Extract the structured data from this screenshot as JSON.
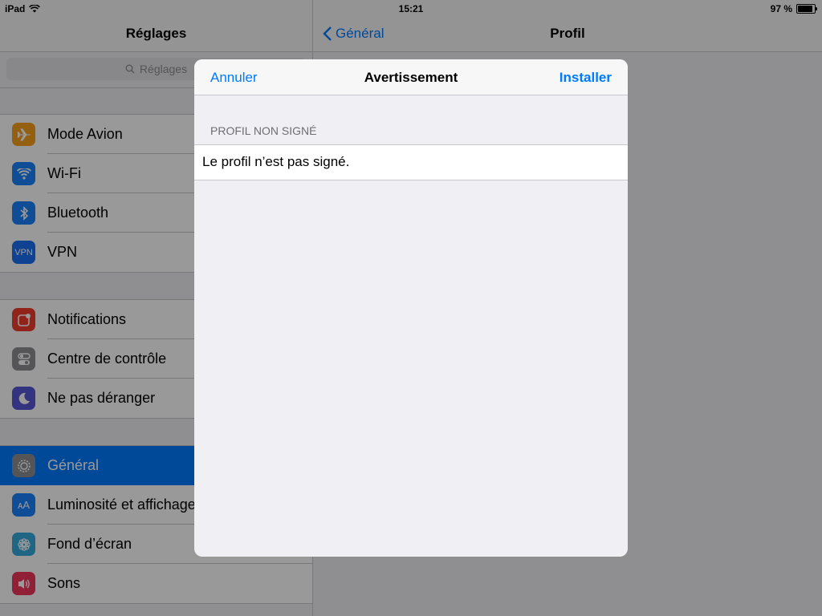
{
  "status": {
    "device": "iPad",
    "time": "15:21",
    "battery": "97 %",
    "battery_level": 0.97
  },
  "master": {
    "title": "Réglages",
    "search_placeholder": "Réglages",
    "groups": [
      {
        "items": [
          {
            "label": "Mode Avion",
            "icon": "airplane-icon",
            "color": "#f7a01a"
          },
          {
            "label": "Wi-Fi",
            "icon": "wifi-icon",
            "color": "#1a82fb"
          },
          {
            "label": "Bluetooth",
            "icon": "bluetooth-icon",
            "color": "#1a82fb"
          },
          {
            "label": "VPN",
            "icon": "vpn-icon",
            "color": "#1a6ef0"
          }
        ]
      },
      {
        "items": [
          {
            "label": "Notifications",
            "icon": "notifications-icon",
            "color": "#f03c2e"
          },
          {
            "label": "Centre de contrôle",
            "icon": "control-center-icon",
            "color": "#8e8e93"
          },
          {
            "label": "Ne pas déranger",
            "icon": "moon-icon",
            "color": "#5856d6"
          }
        ]
      },
      {
        "items": [
          {
            "label": "Général",
            "icon": "gear-icon",
            "color": "#8e8e93",
            "selected": true
          },
          {
            "label": "Luminosité et affichage",
            "icon": "brightness-icon",
            "color": "#1a82fb"
          },
          {
            "label": "Fond d’écran",
            "icon": "wallpaper-icon",
            "color": "#34aadc"
          },
          {
            "label": "Sons",
            "icon": "speaker-icon",
            "color": "#f0365a"
          }
        ]
      }
    ]
  },
  "detail": {
    "back_label": "Général",
    "title": "Profil"
  },
  "modal": {
    "cancel_label": "Annuler",
    "title": "Avertissement",
    "install_label": "Installer",
    "section_header": "PROFIL NON SIGNÉ",
    "message": "Le profil n’est pas signé."
  }
}
